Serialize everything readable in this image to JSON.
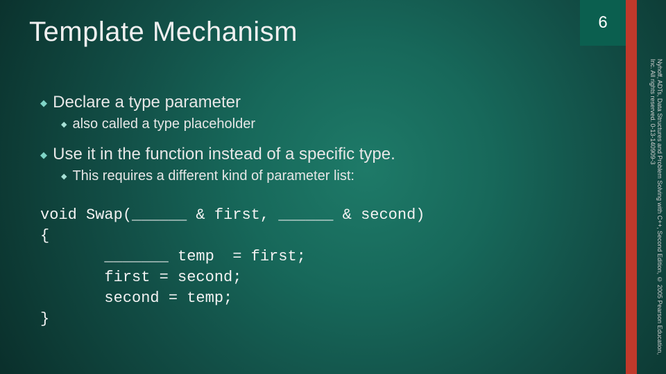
{
  "slide": {
    "title": "Template Mechanism",
    "page_number": "6",
    "copyright": "Nyhoff, ADTs, Data Structures and Problem Solving with C++, Second Edition, © 2005 Pearson Education, Inc. All rights reserved. 0-13-140909-3"
  },
  "bullets": {
    "b1a": "Declare a type parameter",
    "b2a": "also called a type placeholder",
    "b1b": "Use it in the function instead of a specific type.",
    "b2b": "This requires a different kind of parameter list:"
  },
  "code": {
    "line1": "void Swap(______ & first, ______ & second)",
    "line2": "{",
    "line3": "       _______ temp  = first;",
    "line4": "       first = second;",
    "line5": "       second = temp;",
    "line6": "}"
  },
  "glyphs": {
    "diamond": "◆"
  }
}
